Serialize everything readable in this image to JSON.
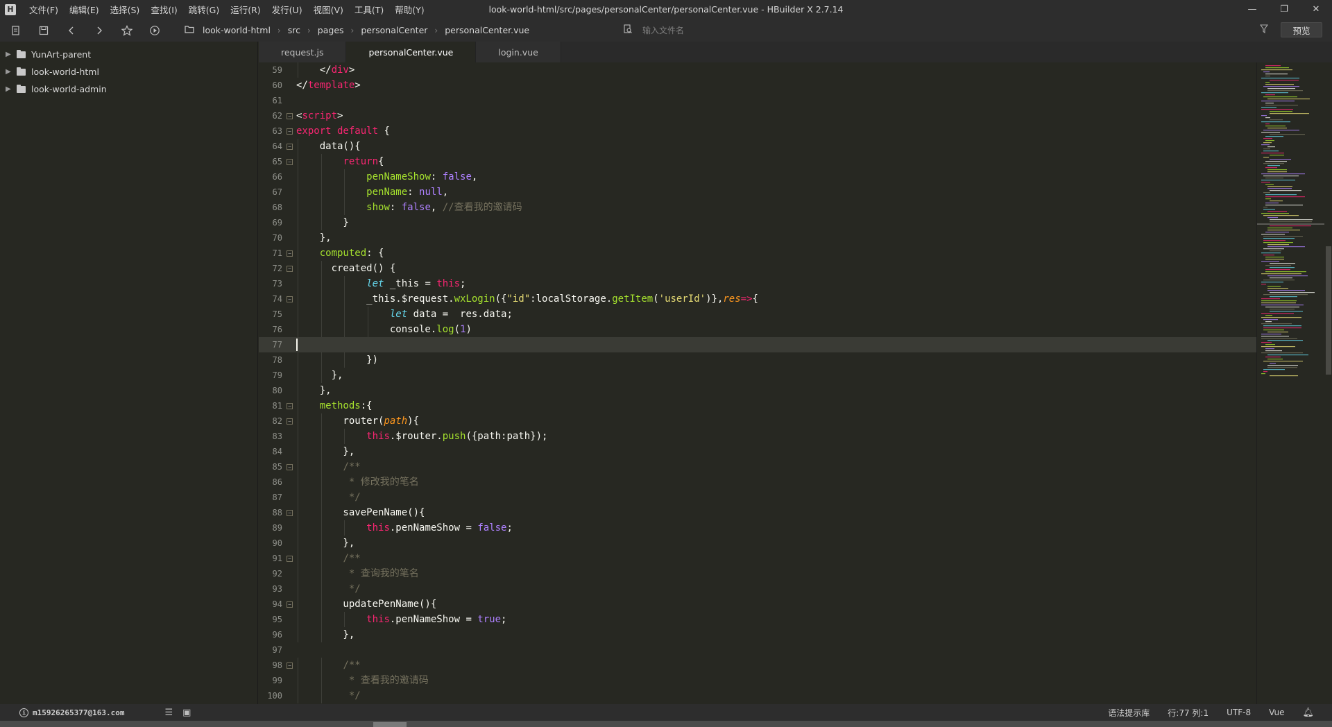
{
  "window": {
    "title": "look-world-html/src/pages/personalCenter/personalCenter.vue - HBuilder X 2.7.14",
    "logo": "H",
    "controls": [
      "—",
      "❐",
      "✕"
    ]
  },
  "menu": [
    "文件(F)",
    "编辑(E)",
    "选择(S)",
    "查找(I)",
    "跳转(G)",
    "运行(R)",
    "发行(U)",
    "视图(V)",
    "工具(T)",
    "帮助(Y)"
  ],
  "toolbar": {
    "breadcrumb": [
      "look-world-html",
      "src",
      "pages",
      "personalCenter",
      "personalCenter.vue"
    ],
    "search_placeholder": "输入文件名",
    "preview_label": "预览"
  },
  "sidebar": {
    "items": [
      {
        "label": "YunArt-parent"
      },
      {
        "label": "look-world-html"
      },
      {
        "label": "look-world-admin"
      }
    ]
  },
  "tabs": [
    {
      "label": "request.js",
      "active": false
    },
    {
      "label": "personalCenter.vue",
      "active": true
    },
    {
      "label": "login.vue",
      "active": false
    }
  ],
  "editor": {
    "current_line": 77,
    "lines": [
      {
        "n": "59",
        "fold": "",
        "indent": 1,
        "html": "    &lt;/<span class=\"tag\">div</span>&gt;"
      },
      {
        "n": "60",
        "fold": "",
        "indent": 0,
        "html": "&lt;/<span class=\"tag\">template</span>&gt;"
      },
      {
        "n": "61",
        "fold": "",
        "indent": 0,
        "html": ""
      },
      {
        "n": "62",
        "fold": "−",
        "indent": 0,
        "html": "&lt;<span class=\"tag\">script</span>&gt;"
      },
      {
        "n": "63",
        "fold": "−",
        "indent": 0,
        "html": "<span class=\"kw\">export default</span> {"
      },
      {
        "n": "64",
        "fold": "−",
        "indent": 1,
        "html": "    data(){"
      },
      {
        "n": "65",
        "fold": "−",
        "indent": 2,
        "html": "        <span class=\"ret\">return</span>{"
      },
      {
        "n": "66",
        "fold": "",
        "indent": 3,
        "html": "            <span class=\"var\">penNameShow</span>: <span class=\"bool\">false</span>,"
      },
      {
        "n": "67",
        "fold": "",
        "indent": 3,
        "html": "            <span class=\"var\">penName</span>: <span class=\"bool\">null</span>,"
      },
      {
        "n": "68",
        "fold": "",
        "indent": 3,
        "html": "            <span class=\"var\">show</span>: <span class=\"bool\">false</span>, <span class=\"cm\">//查看我的邀请码</span>"
      },
      {
        "n": "69",
        "fold": "",
        "indent": 2,
        "html": "        }"
      },
      {
        "n": "70",
        "fold": "",
        "indent": 1,
        "html": "    },"
      },
      {
        "n": "71",
        "fold": "−",
        "indent": 1,
        "html": "    <span class=\"var\">computed</span>: {"
      },
      {
        "n": "72",
        "fold": "−",
        "indent": 2,
        "html": "      created() {"
      },
      {
        "n": "73",
        "fold": "",
        "indent": 3,
        "html": "            <span class=\"it\">let</span> _this = <span class=\"ret\">this</span>;"
      },
      {
        "n": "74",
        "fold": "−",
        "indent": 3,
        "html": "            _this.$request.<span class=\"fn\">wxLogin</span>({<span class=\"str\">\"id\"</span>:localStorage.<span class=\"fn\">getItem</span>(<span class=\"str\">'userId'</span>)},<span class=\"param\">res</span><span class=\"kw\">=&gt;</span>{"
      },
      {
        "n": "75",
        "fold": "",
        "indent": 4,
        "html": "                <span class=\"it\">let</span> data =  res.data;"
      },
      {
        "n": "76",
        "fold": "",
        "indent": 4,
        "html": "                console.<span class=\"fn\">log</span>(<span class=\"bool\">1</span>)"
      },
      {
        "n": "77",
        "fold": "",
        "indent": 0,
        "html": ""
      },
      {
        "n": "78",
        "fold": "",
        "indent": 3,
        "html": "            })"
      },
      {
        "n": "79",
        "fold": "",
        "indent": 2,
        "html": "      },"
      },
      {
        "n": "80",
        "fold": "",
        "indent": 1,
        "html": "    },"
      },
      {
        "n": "81",
        "fold": "−",
        "indent": 1,
        "html": "    <span class=\"var\">methods</span>:{"
      },
      {
        "n": "82",
        "fold": "−",
        "indent": 2,
        "html": "        router(<span class=\"param\">path</span>){"
      },
      {
        "n": "83",
        "fold": "",
        "indent": 3,
        "html": "            <span class=\"ret\">this</span>.$router.<span class=\"fn\">push</span>({path:path});"
      },
      {
        "n": "84",
        "fold": "",
        "indent": 2,
        "html": "        },"
      },
      {
        "n": "85",
        "fold": "−",
        "indent": 2,
        "html": "        <span class=\"cm\">/**</span>"
      },
      {
        "n": "86",
        "fold": "",
        "indent": 2,
        "html": "         <span class=\"cm\">* 修改我的笔名</span>"
      },
      {
        "n": "87",
        "fold": "",
        "indent": 2,
        "html": "         <span class=\"cm\">*/</span>"
      },
      {
        "n": "88",
        "fold": "−",
        "indent": 2,
        "html": "        savePenName(){"
      },
      {
        "n": "89",
        "fold": "",
        "indent": 3,
        "html": "            <span class=\"ret\">this</span>.penNameShow = <span class=\"bool\">false</span>;"
      },
      {
        "n": "90",
        "fold": "",
        "indent": 2,
        "html": "        },"
      },
      {
        "n": "91",
        "fold": "−",
        "indent": 2,
        "html": "        <span class=\"cm\">/**</span>"
      },
      {
        "n": "92",
        "fold": "",
        "indent": 2,
        "html": "         <span class=\"cm\">* 查询我的笔名</span>"
      },
      {
        "n": "93",
        "fold": "",
        "indent": 2,
        "html": "         <span class=\"cm\">*/</span>"
      },
      {
        "n": "94",
        "fold": "−",
        "indent": 2,
        "html": "        updatePenName(){"
      },
      {
        "n": "95",
        "fold": "",
        "indent": 3,
        "html": "            <span class=\"ret\">this</span>.penNameShow = <span class=\"bool\">true</span>;"
      },
      {
        "n": "96",
        "fold": "",
        "indent": 2,
        "html": "        },"
      },
      {
        "n": "97",
        "fold": "",
        "indent": 0,
        "html": ""
      },
      {
        "n": "98",
        "fold": "−",
        "indent": 2,
        "html": "        <span class=\"cm\">/**</span>"
      },
      {
        "n": "99",
        "fold": "",
        "indent": 2,
        "html": "         <span class=\"cm\">* 查看我的邀请码</span>"
      },
      {
        "n": "100",
        "fold": "",
        "indent": 2,
        "html": "         <span class=\"cm\">*/</span>"
      }
    ]
  },
  "statusbar": {
    "account": "m15926265377@163.com",
    "hint_library": "语法提示库",
    "position": "行:77  列:1",
    "encoding": "UTF-8",
    "language": "Vue"
  }
}
